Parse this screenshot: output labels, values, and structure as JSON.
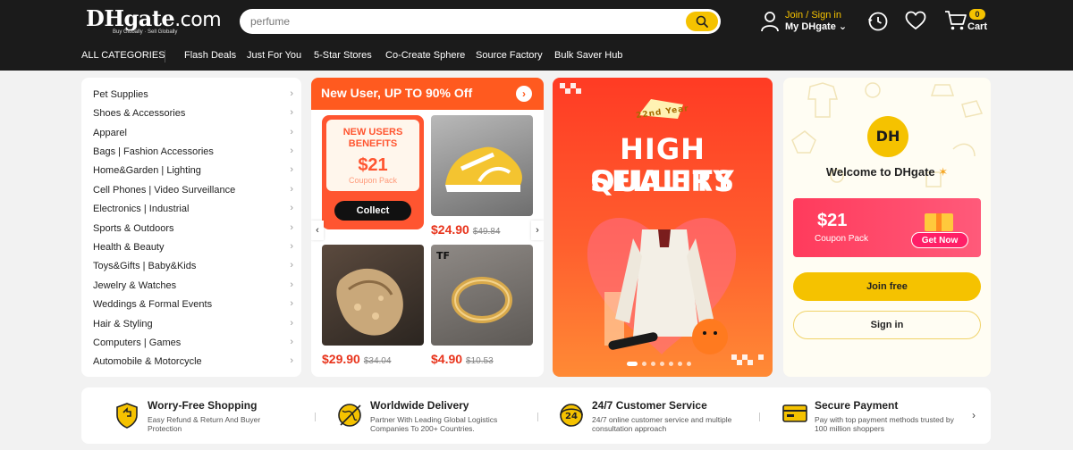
{
  "header": {
    "logo_brand": "DHgate",
    "logo_suffix": ".com",
    "logo_tagline": "Buy Globally · Sell Globally",
    "search_value": "perfume",
    "join_signin": "Join / Sign in",
    "my_dhgate": "My DHgate",
    "cart_count": "0",
    "cart_label": "Cart"
  },
  "nav": {
    "all_categories": "ALL CATEGORIES",
    "items": [
      "Flash Deals",
      "Just For You",
      "5-Star Stores",
      "Co-Create Sphere",
      "Source Factory",
      "Bulk Saver Hub"
    ]
  },
  "categories": [
    "Pet Supplies",
    "Shoes & Accessories",
    "Apparel",
    "Bags | Fashion Accessories",
    "Home&Garden | Lighting",
    "Cell Phones | Video Surveillance",
    "Electronics | Industrial",
    "Sports & Outdoors",
    "Health & Beauty",
    "Toys&Gifts | Baby&Kids",
    "Jewelry & Watches",
    "Weddings & Formal Events",
    "Hair & Styling",
    "Computers | Games",
    "Automobile & Motorcycle"
  ],
  "promo": {
    "title": "New User, UP TO 90% Off",
    "coupon_line1": "NEW USERS",
    "coupon_line2": "BENEFITS",
    "coupon_amount": "$21",
    "coupon_pack": "Coupon Pack",
    "collect": "Collect",
    "products": [
      {
        "price": "$24.90",
        "old": "$49.84"
      },
      {
        "price": "$29.90",
        "old": "$34.04"
      },
      {
        "price": "$4.90",
        "old": "$10.53"
      }
    ]
  },
  "banner": {
    "badge": "22nd Year",
    "line1": "HIGH QUALITY",
    "line2": "SELLERS"
  },
  "welcome": {
    "logo": "DH",
    "text": "Welcome to DHgate",
    "coupon_amount": "$21",
    "coupon_label": "Coupon Pack",
    "get_now": "Get Now",
    "join_free": "Join free",
    "sign_in": "Sign in"
  },
  "features": [
    {
      "title": "Worry-Free Shopping",
      "desc": "Easy Refund & Return And Buyer Protection"
    },
    {
      "title": "Worldwide Delivery",
      "desc": "Partner With Leading Global Logistics Companies To 200+ Countries."
    },
    {
      "title": "24/7 Customer Service",
      "desc": "24/7 online customer service and multiple consultation approach"
    },
    {
      "title": "Secure Payment",
      "desc": "Pay with top payment methods trusted by 100 million shoppers"
    }
  ],
  "colors": {
    "header_bg": "#1b1b1b",
    "accent_yellow": "#f5c200",
    "promo_orange": "#ff5a1f",
    "price_red": "#e8341c",
    "coupon_pink": "#ff3b5c"
  }
}
